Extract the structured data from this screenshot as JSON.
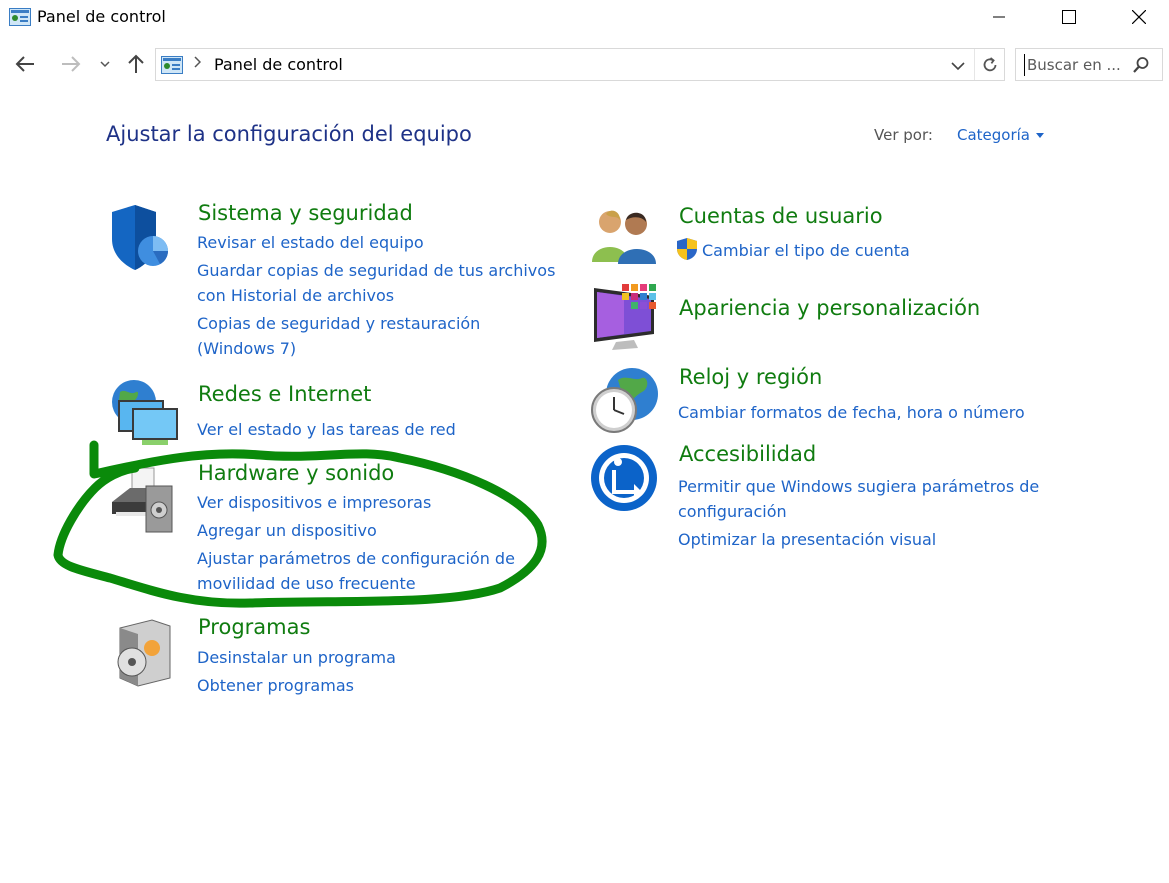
{
  "window": {
    "title": "Panel de control",
    "buttons": {
      "minimize": "minimize",
      "maximize": "maximize",
      "close": "close"
    }
  },
  "navigation": {
    "breadcrumb": "Panel de control",
    "search_placeholder": "Buscar en ..."
  },
  "header": {
    "title": "Ajustar la configuración del equipo",
    "view_by_label": "Ver por:",
    "view_by_value": "Categoría"
  },
  "categories": {
    "sistema": {
      "title": "Sistema y seguridad",
      "links": [
        "Revisar el estado del equipo",
        "Guardar copias de seguridad de tus archivos",
        "con Historial de archivos",
        "Copias de seguridad y restauración",
        "(Windows 7)"
      ]
    },
    "redes": {
      "title": "Redes e Internet",
      "links": [
        "Ver el estado y las tareas de red"
      ]
    },
    "hardware": {
      "title": "Hardware y sonido",
      "links": [
        "Ver dispositivos e impresoras",
        "Agregar un dispositivo",
        "Ajustar parámetros de configuración de",
        "movilidad de uso frecuente"
      ]
    },
    "programas": {
      "title": "Programas",
      "links": [
        "Desinstalar un programa",
        "Obtener programas"
      ]
    },
    "cuentas": {
      "title": "Cuentas de usuario",
      "links": [
        "Cambiar el tipo de cuenta"
      ]
    },
    "apariencia": {
      "title": "Apariencia y personalización",
      "links": []
    },
    "reloj": {
      "title": "Reloj y región",
      "links": [
        "Cambiar formatos de fecha, hora o número"
      ]
    },
    "accesibilidad": {
      "title": "Accesibilidad",
      "links": [
        "Permitir que Windows sugiera parámetros de",
        "configuración",
        "Optimizar la presentación visual"
      ]
    }
  },
  "colors": {
    "link": "#1e64c8",
    "category_title": "#107c10",
    "page_title": "#1e3287",
    "highlight_stroke": "#0a8a0a"
  }
}
